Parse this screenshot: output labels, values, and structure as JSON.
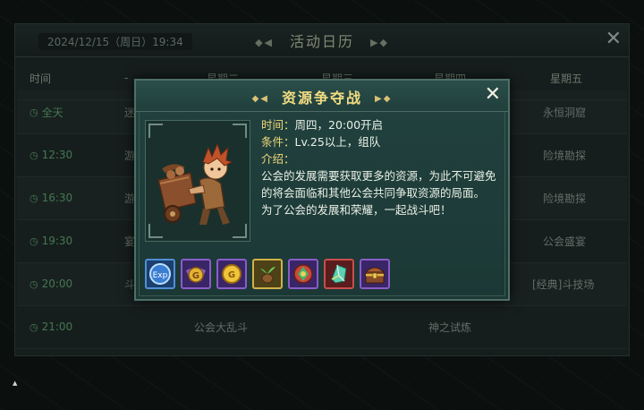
{
  "calendar": {
    "date": "2024/12/15（周日）19:34",
    "title": "活动日历",
    "header": {
      "time": "时间",
      "dash": "-",
      "tue": "星期二",
      "wed": "星期三",
      "thu": "星期四",
      "fri": "星期五"
    },
    "rows": [
      {
        "time": "全天",
        "c1": "迷",
        "fri": "永恒洞窟"
      },
      {
        "time": "12:30",
        "c1": "游",
        "fri": "险境勘探"
      },
      {
        "time": "16:30",
        "c1": "游",
        "fri": "险境勘探"
      },
      {
        "time": "19:30",
        "c1": "宴",
        "fri": "公会盛宴"
      },
      {
        "time": "20:00",
        "c1": "斗",
        "fri": "[经典]斗技场"
      },
      {
        "time": "21:00",
        "tue": "公会大乱斗",
        "thu": "神之试炼"
      }
    ]
  },
  "modal": {
    "title": "资源争夺战",
    "time_label": "时间：",
    "time_value": "周四，20:00开启",
    "cond_label": "条件：",
    "cond_value": "Lv.25以上，组队",
    "intro_label": "介绍：",
    "intro_p1": "公会的发展需要获取更多的资源，为此不可避免的将会面临和其他公会共同争取资源的局面。",
    "intro_p2": "为了公会的发展和荣耀，一起战斗吧！",
    "rewards": [
      {
        "icon": "exp-icon",
        "text": "Exp"
      },
      {
        "icon": "guild-coin-icon",
        "text": "G"
      },
      {
        "icon": "gold-coin-icon",
        "text": "G"
      },
      {
        "icon": "seed-icon",
        "text": ""
      },
      {
        "icon": "gem-icon",
        "text": ""
      },
      {
        "icon": "crystal-icon",
        "text": ""
      },
      {
        "icon": "treasure-chest-icon",
        "text": ""
      }
    ]
  },
  "corner_mark": "▲"
}
